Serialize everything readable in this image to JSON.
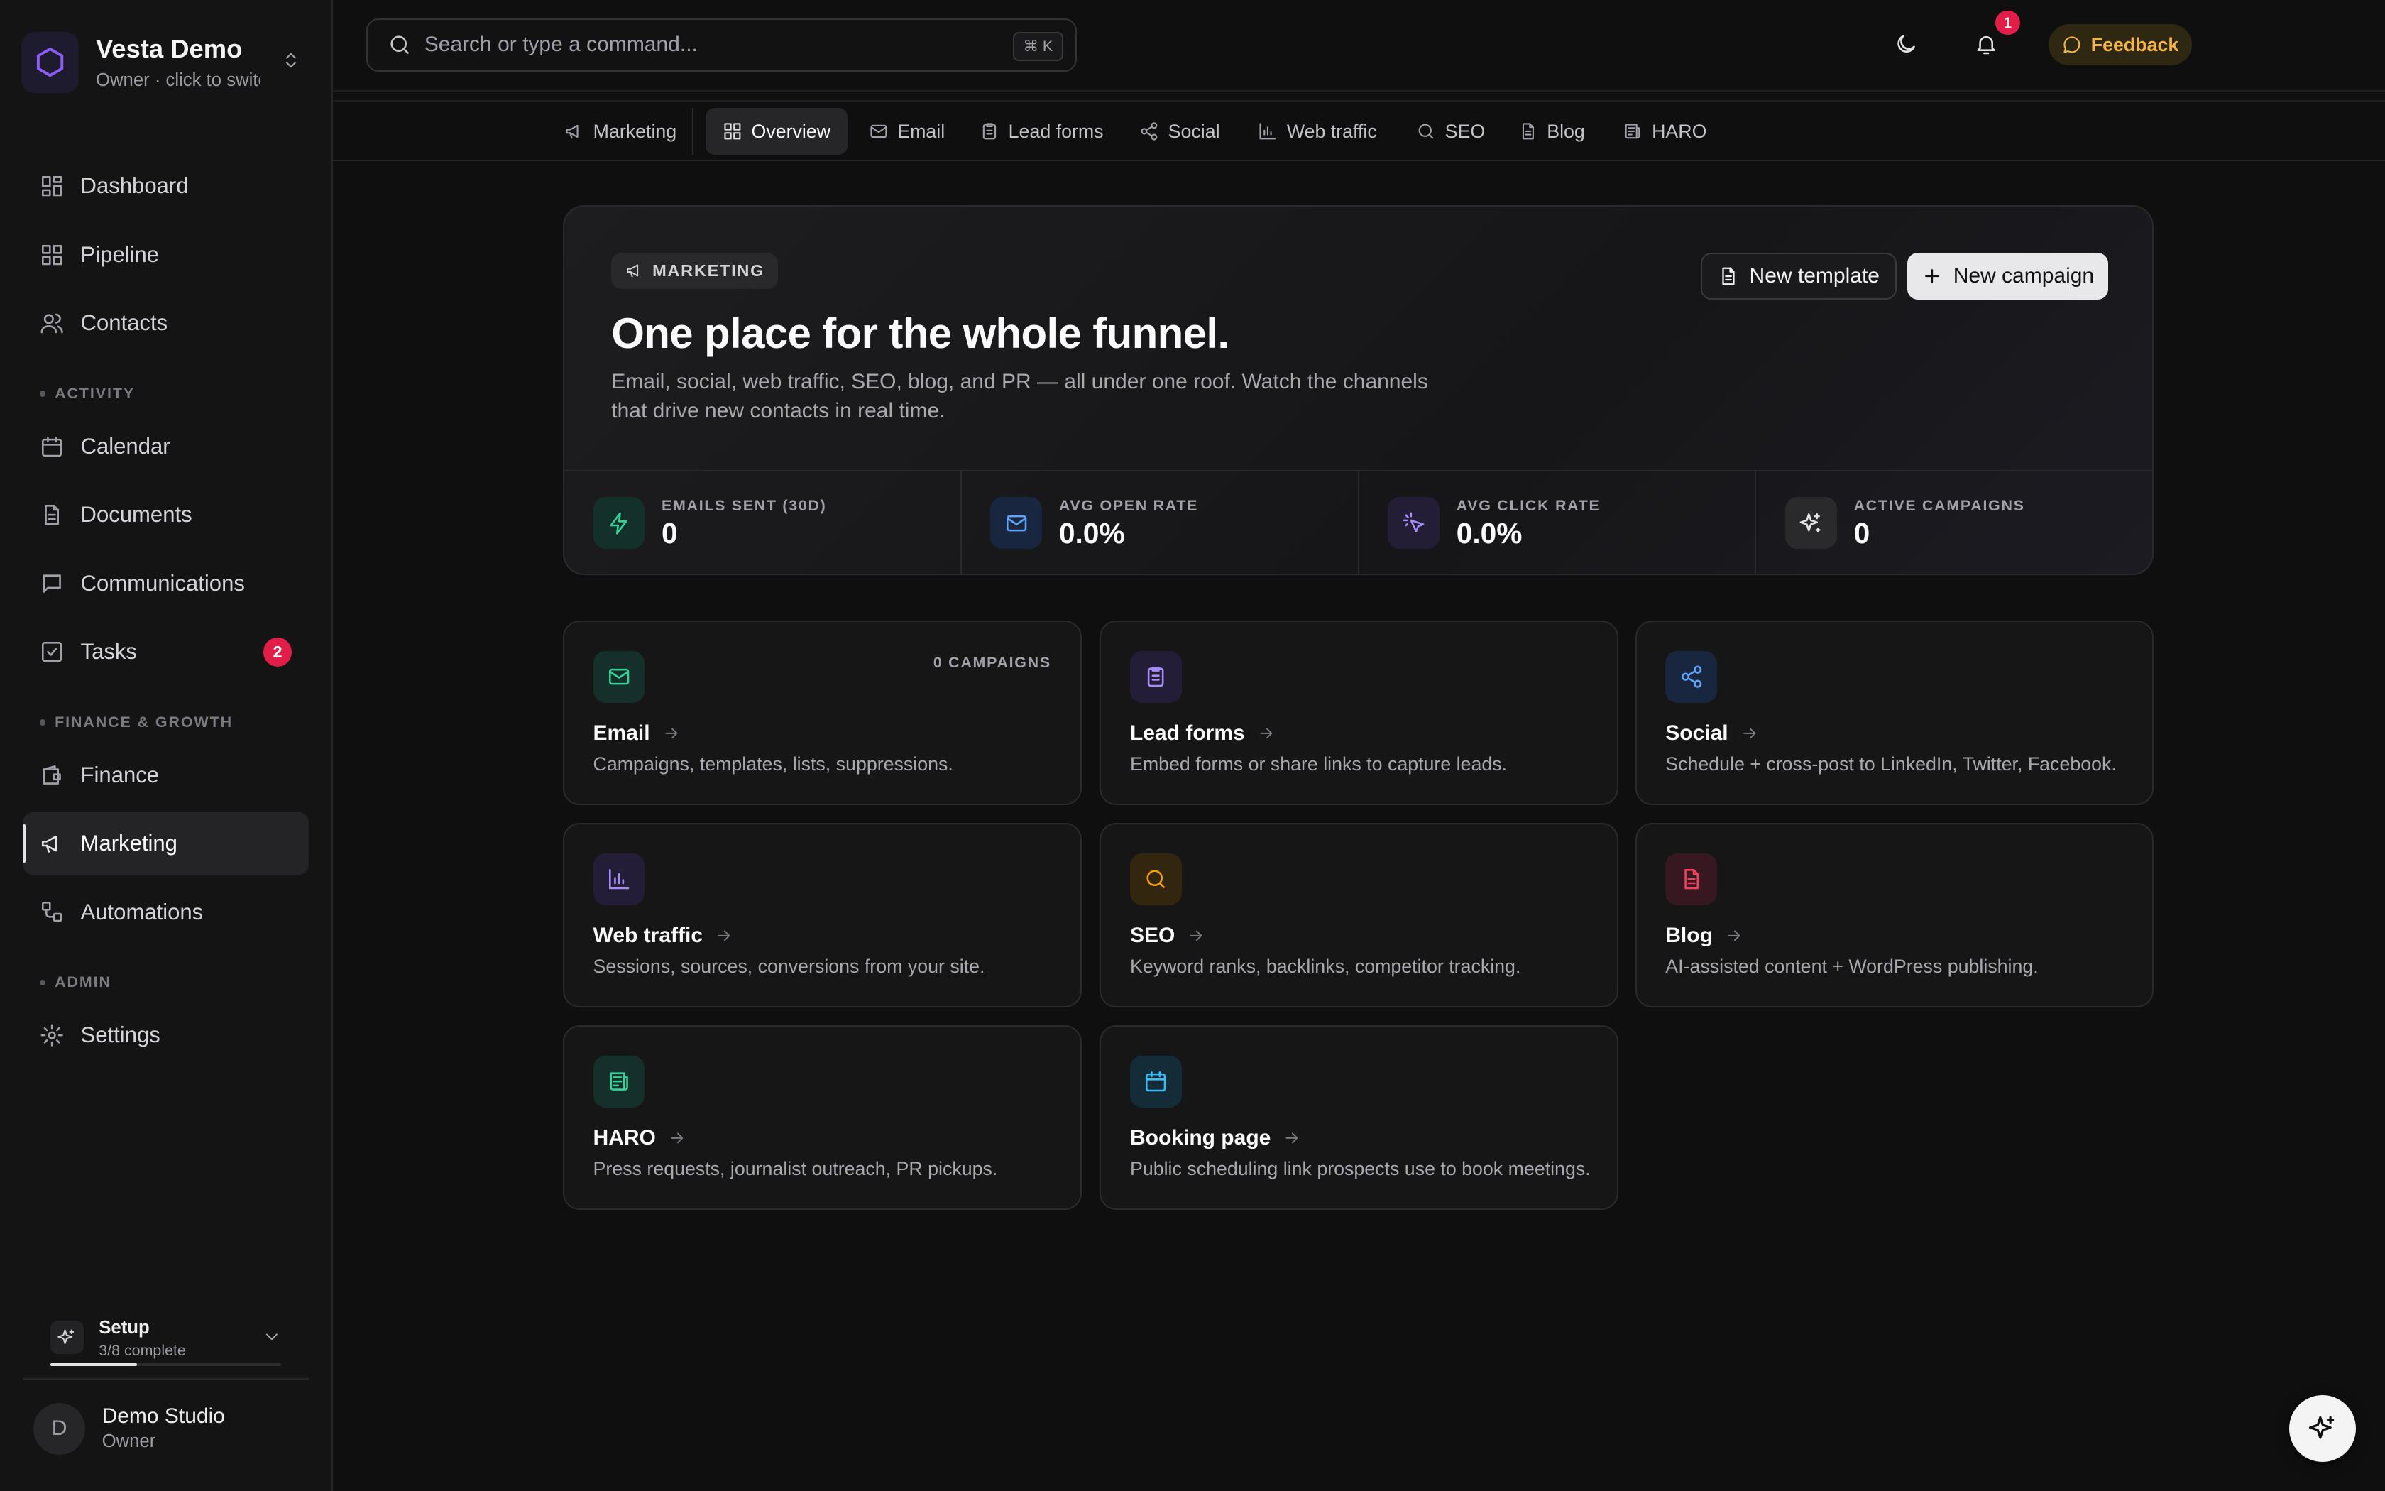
{
  "workspace": {
    "name": "Vesta Demo",
    "subtitle": "Owner · click to switch"
  },
  "sidebar": {
    "items": [
      {
        "label": "Dashboard",
        "icon": "dashboard-icon"
      },
      {
        "label": "Pipeline",
        "icon": "pipeline-icon"
      },
      {
        "label": "Contacts",
        "icon": "contacts-icon"
      },
      {
        "label": "Calendar",
        "icon": "calendar-icon"
      },
      {
        "label": "Documents",
        "icon": "document-icon"
      },
      {
        "label": "Communications",
        "icon": "chat-icon"
      },
      {
        "label": "Tasks",
        "icon": "checkbox-icon",
        "badge": "2"
      },
      {
        "label": "Finance",
        "icon": "wallet-icon"
      },
      {
        "label": "Marketing",
        "icon": "megaphone-icon",
        "active": true
      },
      {
        "label": "Automations",
        "icon": "workflow-icon"
      },
      {
        "label": "Settings",
        "icon": "gear-icon"
      }
    ],
    "sections": [
      "ACTIVITY",
      "FINANCE & GROWTH",
      "ADMIN"
    ],
    "setup": {
      "title": "Setup",
      "progress_text": "3/8 complete",
      "progress": 0.375
    },
    "user": {
      "initial": "D",
      "name": "Demo Studio",
      "role": "Owner"
    }
  },
  "topbar": {
    "search_placeholder": "Search or type a command...",
    "shortcut": "⌘ K",
    "feedback_label": "Feedback",
    "notification_count": "1"
  },
  "tabs": [
    {
      "label": "Marketing",
      "icon": "megaphone-icon"
    },
    {
      "label": "Overview",
      "icon": "grid-icon",
      "active": true
    },
    {
      "label": "Email",
      "icon": "mail-icon"
    },
    {
      "label": "Lead forms",
      "icon": "clipboard-icon"
    },
    {
      "label": "Social",
      "icon": "share-icon"
    },
    {
      "label": "Web traffic",
      "icon": "bar-chart-icon"
    },
    {
      "label": "SEO",
      "icon": "search-icon"
    },
    {
      "label": "Blog",
      "icon": "document-icon"
    },
    {
      "label": "HARO",
      "icon": "newspaper-icon"
    }
  ],
  "hero": {
    "chip": "MARKETING",
    "title": "One place for the whole funnel.",
    "description": "Email, social, web traffic, SEO, blog, and PR — all under one roof. Watch the channels that drive new contacts in real time.",
    "new_template_label": "New template",
    "new_campaign_label": "New campaign",
    "stats": [
      {
        "label": "EMAILS SENT (30D)",
        "value": "0",
        "icon": "bolt-icon",
        "color": "#34d399",
        "bg": "#14302a"
      },
      {
        "label": "AVG OPEN RATE",
        "value": "0.0%",
        "icon": "mail-icon",
        "color": "#60a5fa",
        "bg": "#182640"
      },
      {
        "label": "AVG CLICK RATE",
        "value": "0.0%",
        "icon": "pointer-click-icon",
        "color": "#a78bfa",
        "bg": "#231d36"
      },
      {
        "label": "ACTIVE CAMPAIGNS",
        "value": "0",
        "icon": "sparkles-icon",
        "color": "#e4e4e7",
        "bg": "#2a2a2c"
      }
    ]
  },
  "cards": [
    {
      "title": "Email",
      "desc": "Campaigns, templates, lists, suppressions.",
      "meta": "0 CAMPAIGNS",
      "icon": "mail-icon",
      "color": "#34d399",
      "bg": "#15302a"
    },
    {
      "title": "Lead forms",
      "desc": "Embed forms or share links to capture leads.",
      "icon": "clipboard-icon",
      "color": "#a78bfa",
      "bg": "#241d38"
    },
    {
      "title": "Social",
      "desc": "Schedule + cross-post to LinkedIn, Twitter, Facebook.",
      "icon": "share-icon",
      "color": "#60a5fa",
      "bg": "#182640"
    },
    {
      "title": "Web traffic",
      "desc": "Sessions, sources, conversions from your site.",
      "icon": "bar-chart-icon",
      "color": "#a78bfa",
      "bg": "#241d38"
    },
    {
      "title": "SEO",
      "desc": "Keyword ranks, backlinks, competitor tracking.",
      "icon": "search-icon",
      "color": "#f59e0b",
      "bg": "#33260f"
    },
    {
      "title": "Blog",
      "desc": "AI-assisted content + WordPress publishing.",
      "icon": "document-icon",
      "color": "#f43f5e",
      "bg": "#381820"
    },
    {
      "title": "HARO",
      "desc": "Press requests, journalist outreach, PR pickups.",
      "icon": "newspaper-icon",
      "color": "#34d399",
      "bg": "#15302a"
    },
    {
      "title": "Booking page",
      "desc": "Public scheduling link prospects use to book meetings.",
      "icon": "calendar-icon",
      "color": "#38bdf8",
      "bg": "#142b38"
    }
  ]
}
